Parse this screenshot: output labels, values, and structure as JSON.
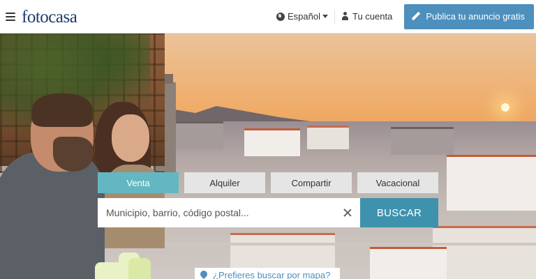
{
  "header": {
    "logo": "fotocasa",
    "language": "Español",
    "account": "Tu cuenta",
    "publish": "Publica tu anuncio gratis"
  },
  "search": {
    "tabs": [
      {
        "label": "Venta",
        "active": true
      },
      {
        "label": "Alquiler",
        "active": false
      },
      {
        "label": "Compartir",
        "active": false
      },
      {
        "label": "Vacacional",
        "active": false
      }
    ],
    "placeholder": "Municipio, barrio, código postal...",
    "button": "BUSCAR",
    "map_link": "¿Prefieres buscar por mapa?"
  },
  "colors": {
    "accent": "#4d8fbd",
    "tab_active": "#63b7c2",
    "search_button": "#3f92ad",
    "logo": "#1e3a6e"
  },
  "icons": [
    "menu-icon",
    "globe-icon",
    "chevron-down-icon",
    "user-icon",
    "pencil-icon",
    "close-icon",
    "map-pin-icon"
  ]
}
